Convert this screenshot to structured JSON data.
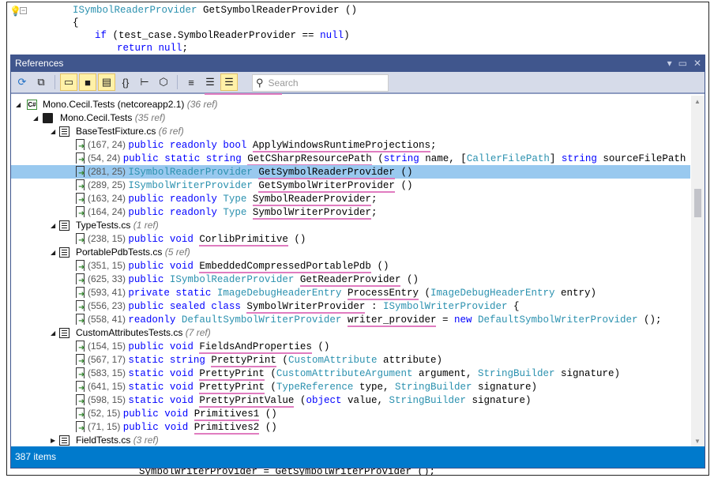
{
  "editor": {
    "lines": [
      [
        [
          "ISymbolReaderProvider ",
          "t"
        ],
        [
          "GetSymbolReaderProvider ()",
          "p"
        ]
      ],
      [
        [
          "{",
          "p"
        ]
      ],
      [
        [
          "if ",
          "k"
        ],
        [
          "(test_case.SymbolReaderProvider == ",
          "p"
        ],
        [
          "null",
          "k"
        ],
        [
          ")",
          "p"
        ]
      ],
      [
        [
          "return ",
          "k"
        ],
        [
          "null",
          "k"
        ],
        [
          ";",
          "p"
        ]
      ]
    ],
    "bottom_line": [
      [
        "SymbolWriterProvider = GetSymbolWriterProvider ();",
        "p"
      ]
    ]
  },
  "panel": {
    "title": "References",
    "toolbar": {
      "buttons": [
        {
          "name": "refresh-icon",
          "glyph": "⟳",
          "on": false
        },
        {
          "name": "new-window-icon",
          "glyph": "⧉",
          "on": false
        },
        {
          "name": "group-project-icon",
          "glyph": "▭",
          "on": true
        },
        {
          "name": "group-namespace-icon",
          "glyph": "■",
          "on": true
        },
        {
          "name": "group-file-icon",
          "glyph": "▤",
          "on": true
        },
        {
          "name": "group-type-icon",
          "glyph": "{}",
          "on": false
        },
        {
          "name": "group-member-icon",
          "glyph": "⊢",
          "on": false
        },
        {
          "name": "group-assembly-icon",
          "glyph": "⬡",
          "on": false
        },
        {
          "name": "view-compact-icon",
          "glyph": "≡",
          "on": false
        },
        {
          "name": "view-list-icon",
          "glyph": "☰",
          "on": false
        },
        {
          "name": "view-detail-icon",
          "glyph": "☰",
          "on": true
        }
      ],
      "search_placeholder": "Search"
    },
    "tree": [
      {
        "level": 0,
        "kind": "project",
        "label": "Mono.Cecil.Tests (netcoreapp2.1)",
        "count": "(36 ref)",
        "expanded": true
      },
      {
        "level": 1,
        "kind": "namespace",
        "label": "Mono.Cecil.Tests",
        "count": "(35 ref)",
        "expanded": true
      },
      {
        "level": 2,
        "kind": "file",
        "label": "BaseTestFixture.cs",
        "count": "(6 ref)",
        "expanded": true
      },
      {
        "level": 3,
        "kind": "ref",
        "pos": "(167, 24)",
        "code": [
          [
            "public readonly bool ",
            "k"
          ],
          [
            "ApplyWindowsRuntimeProjections",
            "m"
          ],
          [
            ";",
            "p"
          ]
        ]
      },
      {
        "level": 3,
        "kind": "ref",
        "pos": "(54, 24)",
        "code": [
          [
            "public static string ",
            "k"
          ],
          [
            "GetCSharpResourcePath",
            "m"
          ],
          [
            " (",
            "p"
          ],
          [
            "string",
            "k"
          ],
          [
            " name, [",
            "p"
          ],
          [
            "CallerFilePath",
            "t"
          ],
          [
            "] ",
            "p"
          ],
          [
            "string",
            "k"
          ],
          [
            " sourceFilePath = ",
            "p"
          ],
          [
            "\"\"",
            "p"
          ],
          [
            ")",
            "p"
          ]
        ]
      },
      {
        "level": 3,
        "kind": "ref",
        "pos": "(281, 25)",
        "selected": true,
        "code": [
          [
            "ISymbolReaderProvider ",
            "t"
          ],
          [
            "GetSymbolReaderProvider",
            "m"
          ],
          [
            " ()",
            "p"
          ]
        ]
      },
      {
        "level": 3,
        "kind": "ref",
        "pos": "(289, 25)",
        "code": [
          [
            "ISymbolWriterProvider ",
            "t"
          ],
          [
            "GetSymbolWriterProvider",
            "m"
          ],
          [
            " ()",
            "p"
          ]
        ]
      },
      {
        "level": 3,
        "kind": "ref",
        "pos": "(163, 24)",
        "code": [
          [
            "public readonly ",
            "k"
          ],
          [
            "Type ",
            "t"
          ],
          [
            "SymbolReaderProvider",
            "m"
          ],
          [
            ";",
            "p"
          ]
        ]
      },
      {
        "level": 3,
        "kind": "ref",
        "pos": "(164, 24)",
        "code": [
          [
            "public readonly ",
            "k"
          ],
          [
            "Type ",
            "t"
          ],
          [
            "SymbolWriterProvider",
            "m"
          ],
          [
            ";",
            "p"
          ]
        ]
      },
      {
        "level": 2,
        "kind": "file",
        "label": "TypeTests.cs",
        "count": "(1 ref)",
        "expanded": true
      },
      {
        "level": 3,
        "kind": "ref",
        "pos": "(238, 15)",
        "code": [
          [
            "public void ",
            "k"
          ],
          [
            "CorlibPrimitive",
            "m"
          ],
          [
            " ()",
            "p"
          ]
        ]
      },
      {
        "level": 2,
        "kind": "file",
        "label": "PortablePdbTests.cs",
        "count": "(5 ref)",
        "expanded": true
      },
      {
        "level": 3,
        "kind": "ref",
        "pos": "(351, 15)",
        "code": [
          [
            "public void ",
            "k"
          ],
          [
            "EmbeddedCompressedPortablePdb",
            "m"
          ],
          [
            " ()",
            "p"
          ]
        ]
      },
      {
        "level": 3,
        "kind": "ref",
        "pos": "(625, 33)",
        "code": [
          [
            "public ",
            "k"
          ],
          [
            "ISymbolReaderProvider ",
            "t"
          ],
          [
            "GetReaderProvider",
            "m"
          ],
          [
            " ()",
            "p"
          ]
        ]
      },
      {
        "level": 3,
        "kind": "ref",
        "pos": "(593, 41)",
        "code": [
          [
            "private static ",
            "k"
          ],
          [
            "ImageDebugHeaderEntry ",
            "t"
          ],
          [
            "ProcessEntry",
            "m"
          ],
          [
            " (",
            "p"
          ],
          [
            "ImageDebugHeaderEntry",
            "t"
          ],
          [
            " entry)",
            "p"
          ]
        ]
      },
      {
        "level": 3,
        "kind": "ref",
        "pos": "(556, 23)",
        "code": [
          [
            "public sealed class ",
            "k"
          ],
          [
            "SymbolWriterProvider",
            "m"
          ],
          [
            " : ",
            "p"
          ],
          [
            "ISymbolWriterProvider",
            "t"
          ],
          [
            " {",
            "p"
          ]
        ]
      },
      {
        "level": 3,
        "kind": "ref",
        "pos": "(558, 41)",
        "code": [
          [
            "readonly ",
            "k"
          ],
          [
            "DefaultSymbolWriterProvider ",
            "t"
          ],
          [
            "writer_provider",
            "m"
          ],
          [
            " = ",
            "p"
          ],
          [
            "new ",
            "k"
          ],
          [
            "DefaultSymbolWriterProvider",
            "t"
          ],
          [
            " ();",
            "p"
          ]
        ]
      },
      {
        "level": 2,
        "kind": "file",
        "label": "CustomAttributesTests.cs",
        "count": "(7 ref)",
        "expanded": true
      },
      {
        "level": 3,
        "kind": "ref",
        "pos": "(154, 15)",
        "code": [
          [
            "public void ",
            "k"
          ],
          [
            "FieldsAndProperties",
            "m"
          ],
          [
            " ()",
            "p"
          ]
        ]
      },
      {
        "level": 3,
        "kind": "ref",
        "pos": "(567, 17)",
        "code": [
          [
            "static string ",
            "k"
          ],
          [
            "PrettyPrint",
            "m"
          ],
          [
            " (",
            "p"
          ],
          [
            "CustomAttribute",
            "t"
          ],
          [
            " attribute)",
            "p"
          ]
        ]
      },
      {
        "level": 3,
        "kind": "ref",
        "pos": "(583, 15)",
        "code": [
          [
            "static void ",
            "k"
          ],
          [
            "PrettyPrint",
            "m"
          ],
          [
            " (",
            "p"
          ],
          [
            "CustomAttributeArgument",
            "t"
          ],
          [
            " argument, ",
            "p"
          ],
          [
            "StringBuilder",
            "t"
          ],
          [
            " signature)",
            "p"
          ]
        ]
      },
      {
        "level": 3,
        "kind": "ref",
        "pos": "(641, 15)",
        "code": [
          [
            "static void ",
            "k"
          ],
          [
            "PrettyPrint",
            "m"
          ],
          [
            " (",
            "p"
          ],
          [
            "TypeReference",
            "t"
          ],
          [
            " type, ",
            "p"
          ],
          [
            "StringBuilder",
            "t"
          ],
          [
            " signature)",
            "p"
          ]
        ]
      },
      {
        "level": 3,
        "kind": "ref",
        "pos": "(598, 15)",
        "code": [
          [
            "static void ",
            "k"
          ],
          [
            "PrettyPrintValue",
            "m"
          ],
          [
            " (",
            "p"
          ],
          [
            "object",
            "k"
          ],
          [
            " value, ",
            "p"
          ],
          [
            "StringBuilder",
            "t"
          ],
          [
            " signature)",
            "p"
          ]
        ]
      },
      {
        "level": 3,
        "kind": "ref",
        "pos": "(52, 15)",
        "code": [
          [
            "public void ",
            "k"
          ],
          [
            "Primitives1",
            "m"
          ],
          [
            " ()",
            "p"
          ]
        ]
      },
      {
        "level": 3,
        "kind": "ref",
        "pos": "(71, 15)",
        "code": [
          [
            "public void ",
            "k"
          ],
          [
            "Primitives2",
            "m"
          ],
          [
            " ()",
            "p"
          ]
        ]
      },
      {
        "level": 2,
        "kind": "file",
        "label": "FieldTests.cs",
        "count": "(3 ref)",
        "expanded": false
      }
    ],
    "status": "387 items"
  },
  "colors": {
    "titlebar": "#40568d",
    "toolbar": "#d6dbe9",
    "status": "#007acc",
    "selection": "#99c9ef",
    "keyword": "#0000ff",
    "type": "#2b91af",
    "highlight": "#e07cc0"
  }
}
